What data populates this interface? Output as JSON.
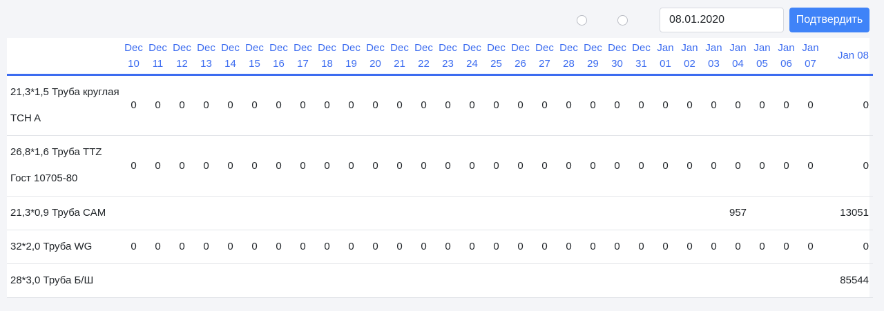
{
  "toolbar": {
    "radio_options": [
      "",
      ""
    ],
    "date_value": "08.01.2020",
    "confirm_label": "Подтвердить",
    "accent_color": "#3f83f8"
  },
  "table": {
    "header_color": "#3c6cf0",
    "columns": [
      {
        "month": "Dec",
        "day": "10"
      },
      {
        "month": "Dec",
        "day": "11"
      },
      {
        "month": "Dec",
        "day": "12"
      },
      {
        "month": "Dec",
        "day": "13"
      },
      {
        "month": "Dec",
        "day": "14"
      },
      {
        "month": "Dec",
        "day": "15"
      },
      {
        "month": "Dec",
        "day": "16"
      },
      {
        "month": "Dec",
        "day": "17"
      },
      {
        "month": "Dec",
        "day": "18"
      },
      {
        "month": "Dec",
        "day": "19"
      },
      {
        "month": "Dec",
        "day": "20"
      },
      {
        "month": "Dec",
        "day": "21"
      },
      {
        "month": "Dec",
        "day": "22"
      },
      {
        "month": "Dec",
        "day": "23"
      },
      {
        "month": "Dec",
        "day": "24"
      },
      {
        "month": "Dec",
        "day": "25"
      },
      {
        "month": "Dec",
        "day": "26"
      },
      {
        "month": "Dec",
        "day": "27"
      },
      {
        "month": "Dec",
        "day": "28"
      },
      {
        "month": "Dec",
        "day": "29"
      },
      {
        "month": "Dec",
        "day": "30"
      },
      {
        "month": "Dec",
        "day": "31"
      },
      {
        "month": "Jan",
        "day": "01"
      },
      {
        "month": "Jan",
        "day": "02"
      },
      {
        "month": "Jan",
        "day": "03"
      },
      {
        "month": "Jan",
        "day": "04"
      },
      {
        "month": "Jan",
        "day": "05"
      },
      {
        "month": "Jan",
        "day": "06"
      },
      {
        "month": "Jan",
        "day": "07"
      }
    ],
    "last_column": "Jan 08",
    "rows": [
      {
        "label_lines": [
          "21,3*1,5 Труба круглая",
          "TCH A"
        ],
        "values": [
          "0",
          "0",
          "0",
          "0",
          "0",
          "0",
          "0",
          "0",
          "0",
          "0",
          "0",
          "0",
          "0",
          "0",
          "0",
          "0",
          "0",
          "0",
          "0",
          "0",
          "0",
          "0",
          "0",
          "0",
          "0",
          "0",
          "0",
          "0",
          "0",
          "0"
        ]
      },
      {
        "label_lines": [
          "26,8*1,6 Труба TTZ",
          "Гост 10705-80"
        ],
        "values": [
          "0",
          "0",
          "0",
          "0",
          "0",
          "0",
          "0",
          "0",
          "0",
          "0",
          "0",
          "0",
          "0",
          "0",
          "0",
          "0",
          "0",
          "0",
          "0",
          "0",
          "0",
          "0",
          "0",
          "0",
          "0",
          "0",
          "0",
          "0",
          "0",
          "0"
        ]
      },
      {
        "label_lines": [
          "21,3*0,9 Труба CAM"
        ],
        "values": [
          "",
          "",
          "",
          "",
          "",
          "",
          "",
          "",
          "",
          "",
          "",
          "",
          "",
          "",
          "",
          "",
          "",
          "",
          "",
          "",
          "",
          "",
          "",
          "",
          "",
          "957",
          "",
          "",
          "",
          "13051"
        ]
      },
      {
        "label_lines": [
          "32*2,0 Труба WG"
        ],
        "values": [
          "0",
          "0",
          "0",
          "0",
          "0",
          "0",
          "0",
          "0",
          "0",
          "0",
          "0",
          "0",
          "0",
          "0",
          "0",
          "0",
          "0",
          "0",
          "0",
          "0",
          "0",
          "0",
          "0",
          "0",
          "0",
          "0",
          "0",
          "0",
          "0",
          "0"
        ]
      },
      {
        "label_lines": [
          "28*3,0 Труба Б/Ш"
        ],
        "values": [
          "",
          "",
          "",
          "",
          "",
          "",
          "",
          "",
          "",
          "",
          "",
          "",
          "",
          "",
          "",
          "",
          "",
          "",
          "",
          "",
          "",
          "",
          "",
          "",
          "",
          "",
          "",
          "",
          "",
          "85544"
        ]
      }
    ]
  }
}
